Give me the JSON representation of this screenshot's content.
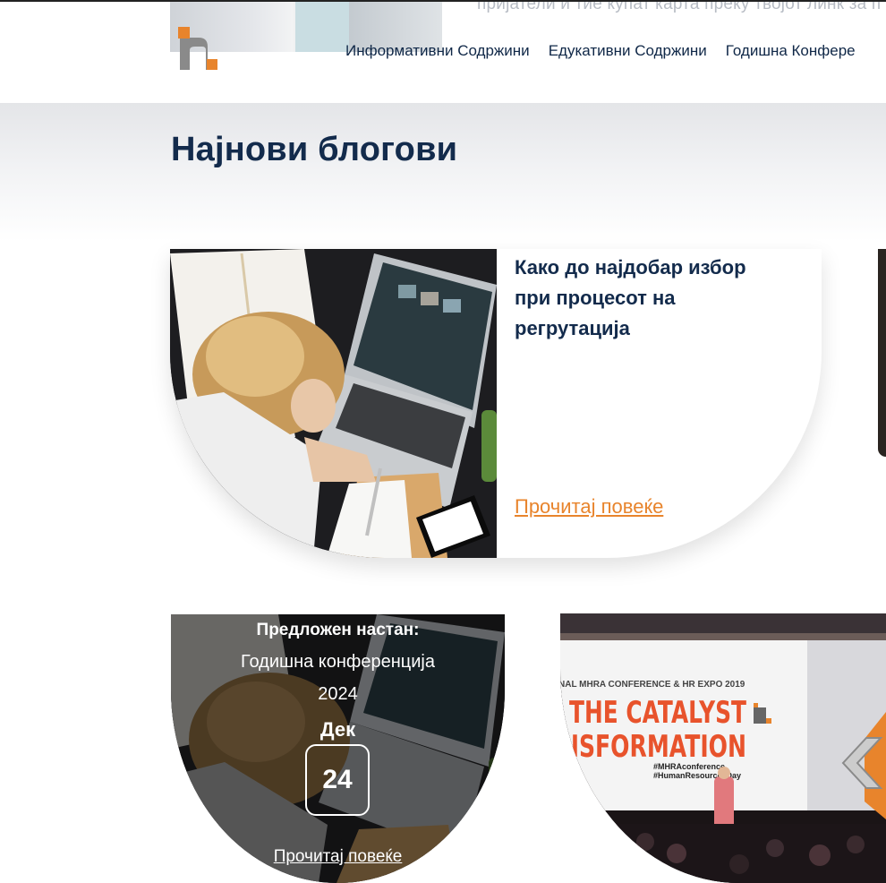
{
  "header": {
    "ticker_text": "пријатели и тие купат карта преку твојот линк за п",
    "nav": [
      "Информативни Содржини",
      "Едукативни Содржини",
      "Годишна Конфере"
    ]
  },
  "section": {
    "title": "Најнови блогови"
  },
  "blog_card": {
    "title": "Како до најдобар избор при процесот на регрутација",
    "read_more": "Прочитај повеќе"
  },
  "event_card": {
    "label": "Предложен настан:",
    "name_line1": "Годишна конференција",
    "name_line2": "2024",
    "month": "Дек",
    "day": "24",
    "read_more": "Прочитај повеќе"
  },
  "conference_card": {
    "banner_top": "NAL MHRA CONFERENCE & HR EXPO 2019",
    "banner_line1": "THE CATALYST",
    "banner_line2": "NSFORMATION",
    "hashtag1": "#MHRAconference",
    "hashtag2": "#HumanResourcesDay"
  },
  "colors": {
    "navy": "#132b4c",
    "accent_orange": "#e8842c",
    "logo_gray": "#8a8a8a"
  },
  "icons": [
    "logo-h-icon",
    "chevron-left-icon"
  ]
}
